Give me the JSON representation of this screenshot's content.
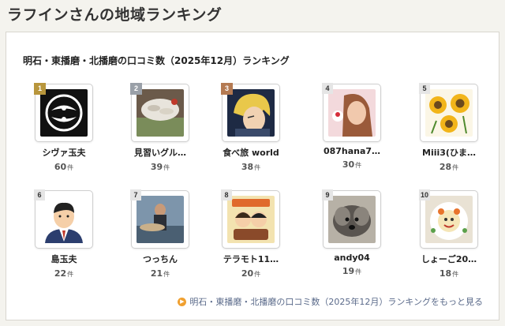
{
  "page": {
    "title": "ラフインさんの地域ランキング"
  },
  "ranking": {
    "heading": "明石・東播磨・北播磨の口コミ数（2025年12月）ランキング",
    "count_unit": "件",
    "medal_colors": {
      "gold": "#b8963c",
      "silver": "#9aa0a8",
      "bronze": "#b47a52"
    },
    "users": [
      {
        "rank": "1",
        "name": "シヴァ玉夫",
        "count": "60",
        "avatar": "family-crest-avatar"
      },
      {
        "rank": "2",
        "name": "見習いグル…",
        "count": "39",
        "avatar": "food-photo-avatar"
      },
      {
        "rank": "3",
        "name": "食べ旅 world",
        "count": "38",
        "avatar": "anime-character-avatar"
      },
      {
        "rank": "4",
        "name": "087hana7…",
        "count": "30",
        "avatar": "person-photo-avatar"
      },
      {
        "rank": "5",
        "name": "Miii3(ひま…",
        "count": "28",
        "avatar": "sunflower-drawing-avatar"
      },
      {
        "rank": "6",
        "name": "島玉夫",
        "count": "22",
        "avatar": "businessman-illustration-avatar"
      },
      {
        "rank": "7",
        "name": "つっちん",
        "count": "21",
        "avatar": "fishing-photo-avatar"
      },
      {
        "rank": "8",
        "name": "テラモト11…",
        "count": "20",
        "avatar": "couple-illustration-avatar"
      },
      {
        "rank": "9",
        "name": "andy04",
        "count": "19",
        "avatar": "dog-photo-avatar"
      },
      {
        "rank": "10",
        "name": "しょーご20…",
        "count": "18",
        "avatar": "plated-dish-avatar"
      }
    ],
    "more_link": "明石・東播磨・北播磨の口コミ数（2025年12月）ランキングをもっと見る"
  }
}
